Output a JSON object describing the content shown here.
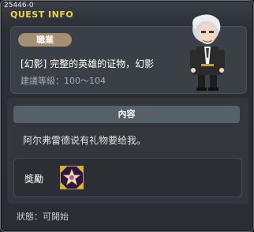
{
  "quest": {
    "id": "25446-0",
    "window_title": "QUEST INFO",
    "job_label": "職業",
    "name": "[幻影] 完整的英雄的证物，幻影",
    "level_text": "建議等級：100～104",
    "content_header": "內容",
    "content_text": "阿尔弗雷德说有礼物要给我。",
    "reward_label": "獎勵",
    "status_text": "狀態：可開始"
  },
  "icons": {
    "npc": "alfred-npc-portrait",
    "reward": "star-item-icon"
  },
  "colors": {
    "title": "#e8d44a",
    "badge": "#a48e74",
    "content_header": "#556068"
  }
}
